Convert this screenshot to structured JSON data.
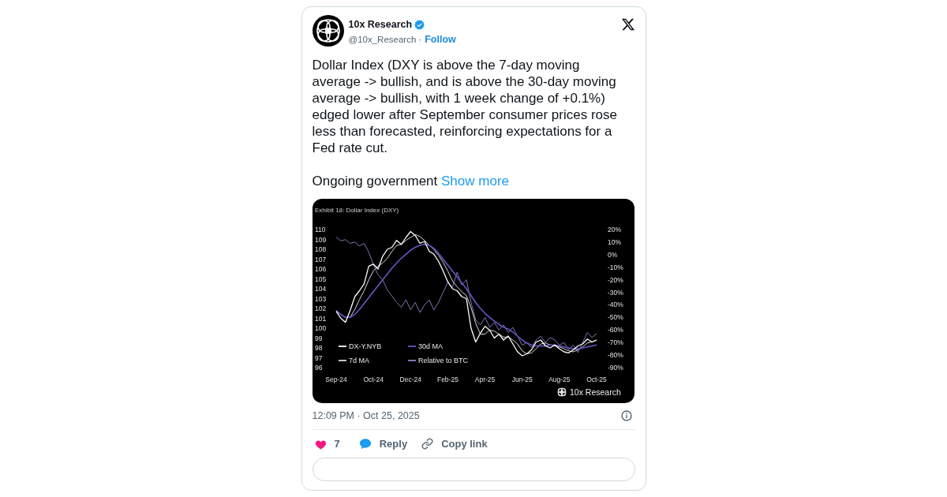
{
  "tweet": {
    "author": {
      "name": "10x Research",
      "verified": true,
      "handle": "@10x_Research",
      "separator": "·",
      "follow": "Follow"
    },
    "paragraphs": [
      {
        "text": "Dollar Index (DXY is above the 7-day moving average -> bullish, and is above the 30-day moving average -> bullish, with 1 week change of +0.1%) edged lower after September consumer prices rose less than forecasted, reinforcing expectations for a Fed rate cut."
      },
      {
        "text": "Ongoing government",
        "link": "Show more"
      }
    ],
    "image": {
      "chart_data": {
        "type": "line",
        "title": "Exhibit 18: Dollar Index (DXY)",
        "categories": [
          "Sep-24",
          null,
          null,
          null,
          null,
          null,
          null,
          null,
          "Oct-24",
          null,
          null,
          null,
          null,
          null,
          null,
          null,
          "Dec-24",
          null,
          null,
          null,
          null,
          null,
          null,
          null,
          "Feb-25",
          null,
          null,
          null,
          null,
          null,
          null,
          null,
          "Apr-25",
          null,
          null,
          null,
          null,
          null,
          null,
          null,
          "Jun-25",
          null,
          null,
          null,
          null,
          null,
          null,
          null,
          "Aug-25",
          null,
          null,
          null,
          null,
          null,
          null,
          null,
          "Oct-25"
        ],
        "ylim": [
          96,
          110
        ],
        "y2lim": [
          -90,
          20
        ],
        "yticks": [
          110,
          109,
          108,
          107,
          106,
          105,
          104,
          103,
          102,
          101,
          100,
          99,
          98,
          97,
          96
        ],
        "y2ticks": [
          {
            "value": 20,
            "label": "20%"
          },
          {
            "value": 10,
            "label": "10%"
          },
          {
            "value": 0,
            "label": "0%"
          },
          {
            "value": -10,
            "label": "-10%"
          },
          {
            "value": -20,
            "label": "-20%"
          },
          {
            "value": -30,
            "label": "-30%"
          },
          {
            "value": -40,
            "label": "-40%"
          },
          {
            "value": -50,
            "label": "-50%"
          },
          {
            "value": -60,
            "label": "-60%"
          },
          {
            "value": -70,
            "label": "-70%"
          },
          {
            "value": -80,
            "label": "-80%"
          },
          {
            "value": -90,
            "label": "-90%"
          }
        ],
        "legend": "lower left",
        "series": [
          {
            "name": "DX-Y.NYB",
            "color": "#ffffff",
            "axis": "y",
            "values": [
              101.7,
              101.0,
              100.6,
              101.8,
              103.2,
              103.8,
              104.5,
              106.3,
              106.5,
              106.0,
              107.3,
              108.0,
              108.2,
              108.9,
              108.5,
              109.2,
              109.8,
              109.4,
              108.6,
              108.8,
              107.8,
              107.5,
              106.8,
              105.8,
              104.7,
              104.0,
              103.8,
              103.2,
              103.0,
              100.0,
              98.6,
              99.5,
              100.2,
              99.8,
              99.0,
              99.4,
              98.8,
              99.2,
              98.4,
              97.6,
              97.2,
              97.4,
              97.8,
              98.6,
              98.8,
              98.2,
              98.0,
              98.3,
              97.9,
              97.6,
              97.5,
              97.8,
              98.2,
              98.4,
              98.9,
              98.6,
              98.8
            ]
          },
          {
            "name": "30d MA",
            "color": "#6457c4",
            "axis": "y",
            "values": [
              101.8,
              101.4,
              101.1,
              101.1,
              101.4,
              101.9,
              102.5,
              103.1,
              103.7,
              104.3,
              104.9,
              105.5,
              106.1,
              106.6,
              107.1,
              107.5,
              107.9,
              108.2,
              108.4,
              108.5,
              108.4,
              108.1,
              107.6,
              107.0,
              106.4,
              105.8,
              105.2,
              104.6,
              104.0,
              103.3,
              102.6,
              102.0,
              101.5,
              101.1,
              100.7,
              100.4,
              100.1,
              99.9,
              99.6,
              99.2,
              98.8,
              98.5,
              98.3,
              98.2,
              98.2,
              98.2,
              98.3,
              98.3,
              98.2,
              98.1,
              98.0,
              97.9,
              97.9,
              98.0,
              98.1,
              98.2,
              98.3
            ]
          },
          {
            "name": "7d MA",
            "color": "#d9d9d9",
            "axis": "y",
            "values": [
              101.7,
              101.4,
              101.1,
              101.1,
              101.9,
              102.9,
              103.8,
              104.9,
              105.8,
              106.3,
              106.6,
              107.1,
              107.8,
              108.4,
              108.5,
              108.9,
              109.2,
              109.5,
              109.3,
              108.9,
              108.4,
              108.0,
              107.4,
              106.7,
              105.8,
              104.8,
              104.2,
              103.7,
              103.3,
              102.1,
              100.5,
              99.4,
              99.4,
              99.8,
              99.7,
              99.4,
              99.1,
              99.1,
              98.8,
              98.4,
              97.7,
              97.4,
              97.5,
              97.9,
              98.4,
              98.5,
              98.3,
              98.2,
              98.1,
              97.9,
              97.7,
              97.6,
              97.8,
              98.1,
              98.5,
              98.6,
              98.8
            ]
          },
          {
            "name": "Relative to BTC",
            "color": "#8b84c9",
            "axis": "y2",
            "values": [
              14,
              11,
              12,
              9,
              10,
              7,
              9,
              2,
              -8,
              -16,
              -20,
              -28,
              -33,
              -38,
              -42,
              -36,
              -44,
              -38,
              -46,
              -40,
              -36,
              -44,
              -38,
              -30,
              -22,
              -26,
              -14,
              -24,
              -20,
              -38,
              -52,
              -56,
              -50,
              -58,
              -54,
              -60,
              -56,
              -62,
              -58,
              -65,
              -72,
              -70,
              -74,
              -68,
              -65,
              -70,
              -66,
              -68,
              -72,
              -70,
              -76,
              -72,
              -78,
              -70,
              -62,
              -66,
              -63
            ]
          }
        ]
      },
      "credit": "10x Research"
    },
    "timestamp": "12:09 PM · Oct 25, 2025",
    "actions": [
      {
        "kind": "like",
        "label": "7"
      },
      {
        "kind": "reply",
        "label": "Reply"
      },
      {
        "kind": "copy_link",
        "label": "Copy link"
      }
    ]
  }
}
